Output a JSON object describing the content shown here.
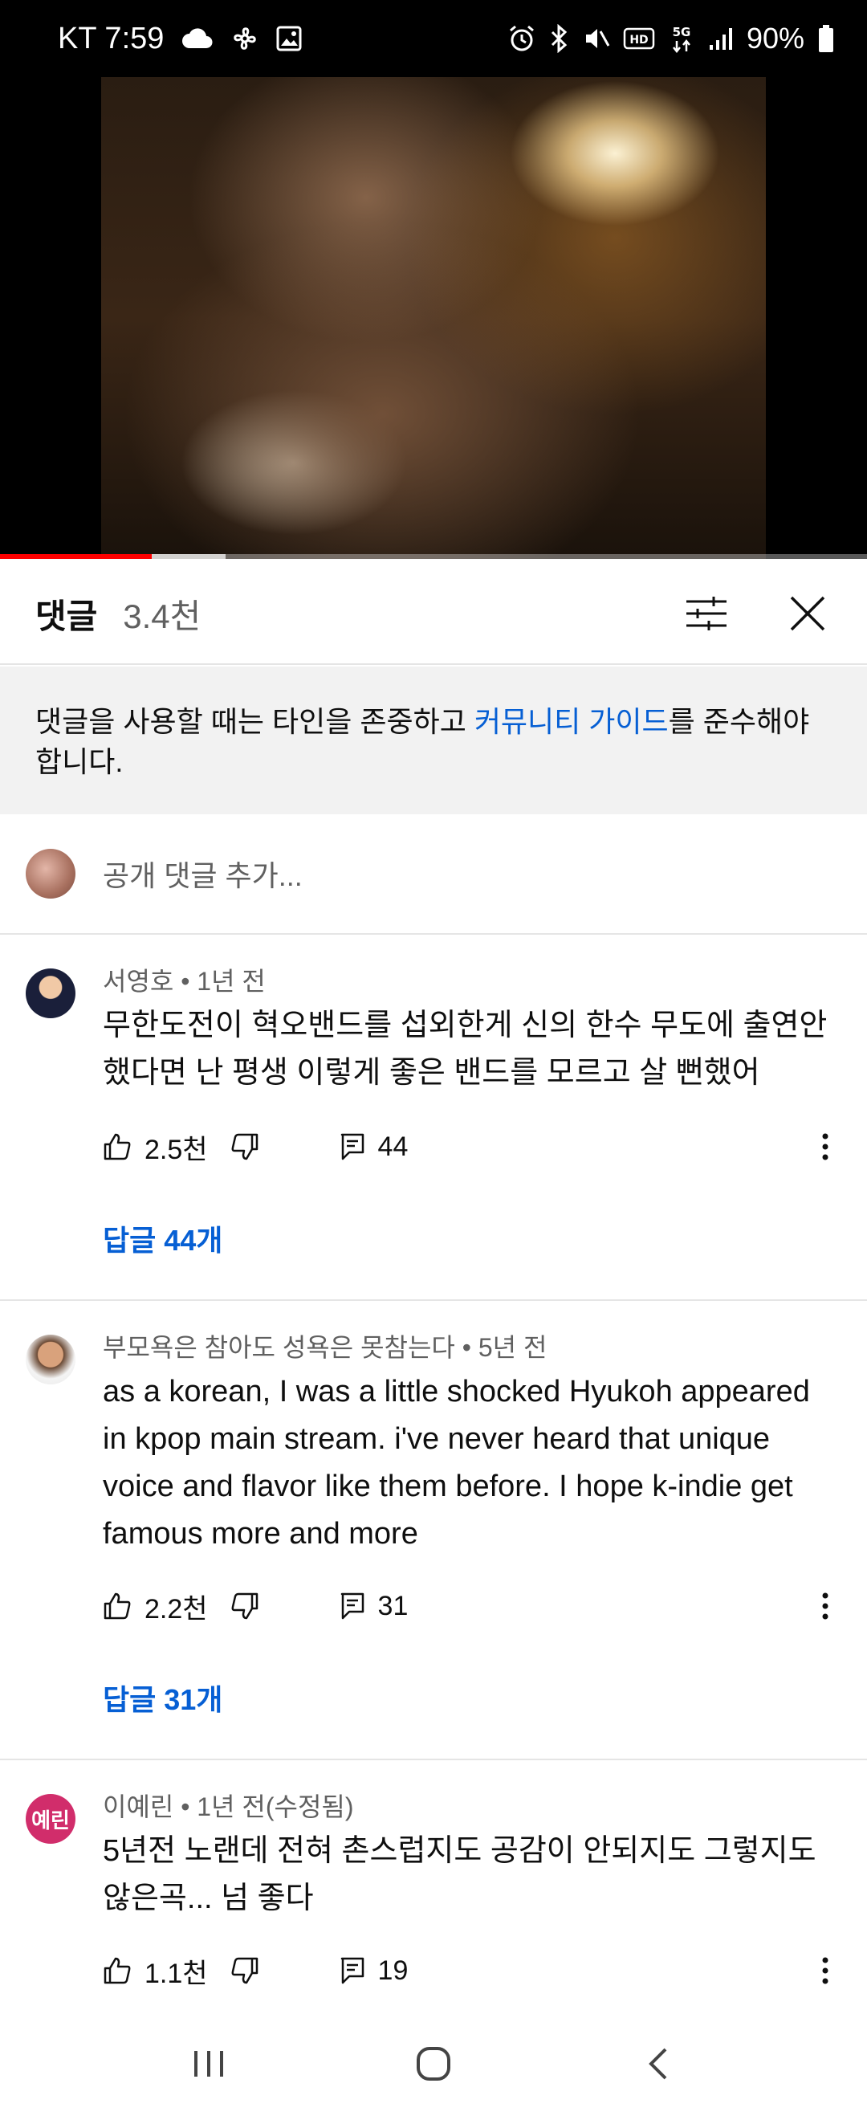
{
  "status_bar": {
    "carrier_time": "KT 7:59",
    "battery": "90%",
    "left_icons": [
      "cloud-icon",
      "fan-icon",
      "image-icon"
    ],
    "right_icons": [
      "alarm-icon",
      "bluetooth-icon",
      "mute-icon",
      "hd-icon",
      "5g-icon",
      "signal-icon",
      "battery-icon"
    ]
  },
  "video": {
    "played_fraction": 0.175,
    "buffered_fraction": 0.26
  },
  "comments_panel": {
    "title": "댓글",
    "count": "3.4천",
    "guide_text_before": "댓글을 사용할 때는 타인을 존중하고 ",
    "guide_link": "커뮤니티 가이드",
    "guide_text_after": "를 준수해야 합니다.",
    "add_placeholder": "공개 댓글 추가..."
  },
  "comments": [
    {
      "author_meta": "서영호 • 1년 전",
      "text": "무한도전이 혁오밴드를 섭외한게 신의 한수 무도에 출연안했다면 난 평생 이렇게 좋은 밴드를 모르고 살 뻔했어",
      "likes": "2.5천",
      "replies_count": "44",
      "replies_link": "답글 44개"
    },
    {
      "author_meta": "부모욕은 참아도 성욕은 못참는다 • 5년 전",
      "text": "as a korean, I was a little shocked Hyukoh appeared in kpop main stream. i've never heard that unique voice and flavor like them before. I hope k-indie get famous more and more",
      "likes": "2.2천",
      "replies_count": "31",
      "replies_link": "답글 31개"
    },
    {
      "author_meta": "이예린 • 1년 전(수정됨)",
      "avatar_text": "예린",
      "text": "5년전 노랜데 전혀 촌스럽지도 공감이 안되지도 그렇지도 않은곡... 넘 좋다",
      "likes": "1.1천",
      "replies_count": "19"
    }
  ],
  "colors": {
    "accent_link": "#065fd4",
    "progress_red": "#ff0000",
    "avatar_pink": "#d12d6b"
  }
}
